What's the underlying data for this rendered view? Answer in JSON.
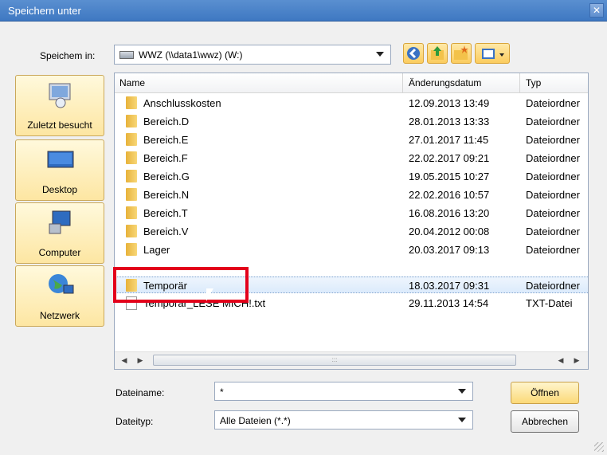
{
  "window": {
    "title": "Speichern unter",
    "close": "✕"
  },
  "save_in": {
    "label": "Speichem in:",
    "value": "WWZ (\\\\data1\\wwz) (W:)"
  },
  "toolbar": {
    "back_icon": "back-icon",
    "up_icon": "up-folder-icon",
    "new_folder_icon": "new-folder-icon",
    "view_icon": "view-menu-icon"
  },
  "places": [
    {
      "label": "Zuletzt besucht",
      "icon": "recent-icon"
    },
    {
      "label": "Desktop",
      "icon": "desktop-icon"
    },
    {
      "label": "Computer",
      "icon": "computer-icon"
    },
    {
      "label": "Netzwerk",
      "icon": "network-icon"
    }
  ],
  "columns": {
    "name": "Name",
    "date": "Änderungsdatum",
    "type": "Typ"
  },
  "files": [
    {
      "name": "Anschlusskosten",
      "date": "12.09.2013 13:49",
      "type": "Dateiordner",
      "kind": "folder"
    },
    {
      "name": "Bereich.D",
      "date": "28.01.2013 13:33",
      "type": "Dateiordner",
      "kind": "folder"
    },
    {
      "name": "Bereich.E",
      "date": "27.01.2017 11:45",
      "type": "Dateiordner",
      "kind": "folder"
    },
    {
      "name": "Bereich.F",
      "date": "22.02.2017 09:21",
      "type": "Dateiordner",
      "kind": "folder"
    },
    {
      "name": "Bereich.G",
      "date": "19.05.2015 10:27",
      "type": "Dateiordner",
      "kind": "folder"
    },
    {
      "name": "Bereich.N",
      "date": "22.02.2016 10:57",
      "type": "Dateiordner",
      "kind": "folder"
    },
    {
      "name": "Bereich.T",
      "date": "16.08.2016 13:20",
      "type": "Dateiordner",
      "kind": "folder"
    },
    {
      "name": "Bereich.V",
      "date": "20.04.2012 00:08",
      "type": "Dateiordner",
      "kind": "folder"
    },
    {
      "name": "Lager",
      "date": "20.03.2017 09:13",
      "type": "Dateiordner",
      "kind": "folder"
    },
    {
      "name": "Temporär",
      "date": "18.03.2017 09:31",
      "type": "Dateiordner",
      "kind": "folder"
    },
    {
      "name": "Temporär_LESE MICH!.txt",
      "date": "29.11.2013 14:54",
      "type": "TXT-Datei",
      "kind": "file"
    }
  ],
  "filename": {
    "label": "Dateiname:",
    "value": "*"
  },
  "filetype": {
    "label": "Dateityp:",
    "value": "Alle Dateien (*.*)"
  },
  "buttons": {
    "open": "Öffnen",
    "cancel": "Abbrechen"
  },
  "scroll": {
    "grip": ":::"
  },
  "colors": {
    "title_bar": "#4a82c8",
    "highlight": "#e3001b",
    "selection": "#dcebfc"
  }
}
